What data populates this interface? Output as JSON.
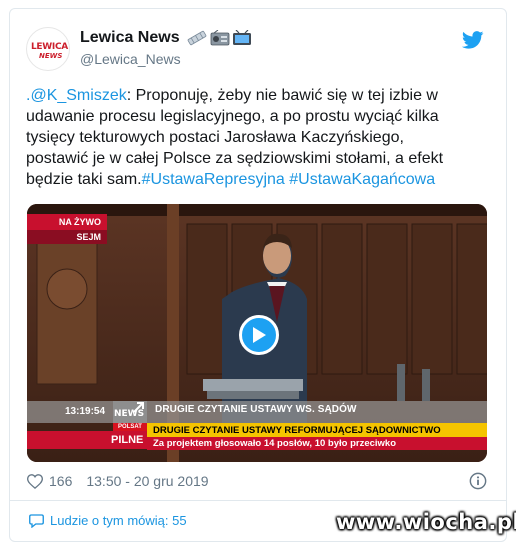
{
  "account": {
    "display_name": "Lewica News",
    "handle": "@Lewica_News",
    "avatar_text_1": "LEWICA",
    "avatar_text_2": "NEWS",
    "emoji_icons": [
      "satellite-antenna-icon",
      "radio-icon",
      "television-icon"
    ]
  },
  "tweet": {
    "mention": ".@K_Smiszek",
    "body": ": Proponuję, żeby nie bawić się w tej izbie w udawanie procesu legislacyjnego, a po prostu wyciąć kilka tysięcy tekturowych postaci Jarosława Kaczyńskiego, postawić je w całej Polsce za sędziowskimi stołami, a efekt będzie taki sam.",
    "hashtag_1": "#UstawaRepresyjna",
    "hashtag_2": "#UstawaKagańcowa"
  },
  "video": {
    "live_label": "NA ŻYWO",
    "channel_label": "SEJM",
    "time": "13:19:54",
    "news_logo": "NEWS",
    "news_logo_sub": "POLSAT",
    "headline": "DRUGIE CZYTANIE USTAWY WS. SĄDÓW",
    "subheadline": "DRUGIE CZYTANIE USTAWY REFORMUJĄCEJ SĄDOWNICTWO",
    "urgent_label": "PILNE",
    "bottom_line": "Za projektem głosowało 14 posłów, 10 było przeciwko"
  },
  "actions": {
    "like_count": "166",
    "timestamp": "13:50 - 20 gru 2019"
  },
  "footer": {
    "people_talking": "Ludzie o tym mówią: 55"
  },
  "watermark": "www.wiocha.pl",
  "colors": {
    "link": "#1b95e0",
    "twitter_blue": "#1da1f2",
    "text": "#14171a",
    "secondary": "#657786",
    "ticker_red": "#c8102e",
    "ticker_yellow": "#f5c400"
  }
}
